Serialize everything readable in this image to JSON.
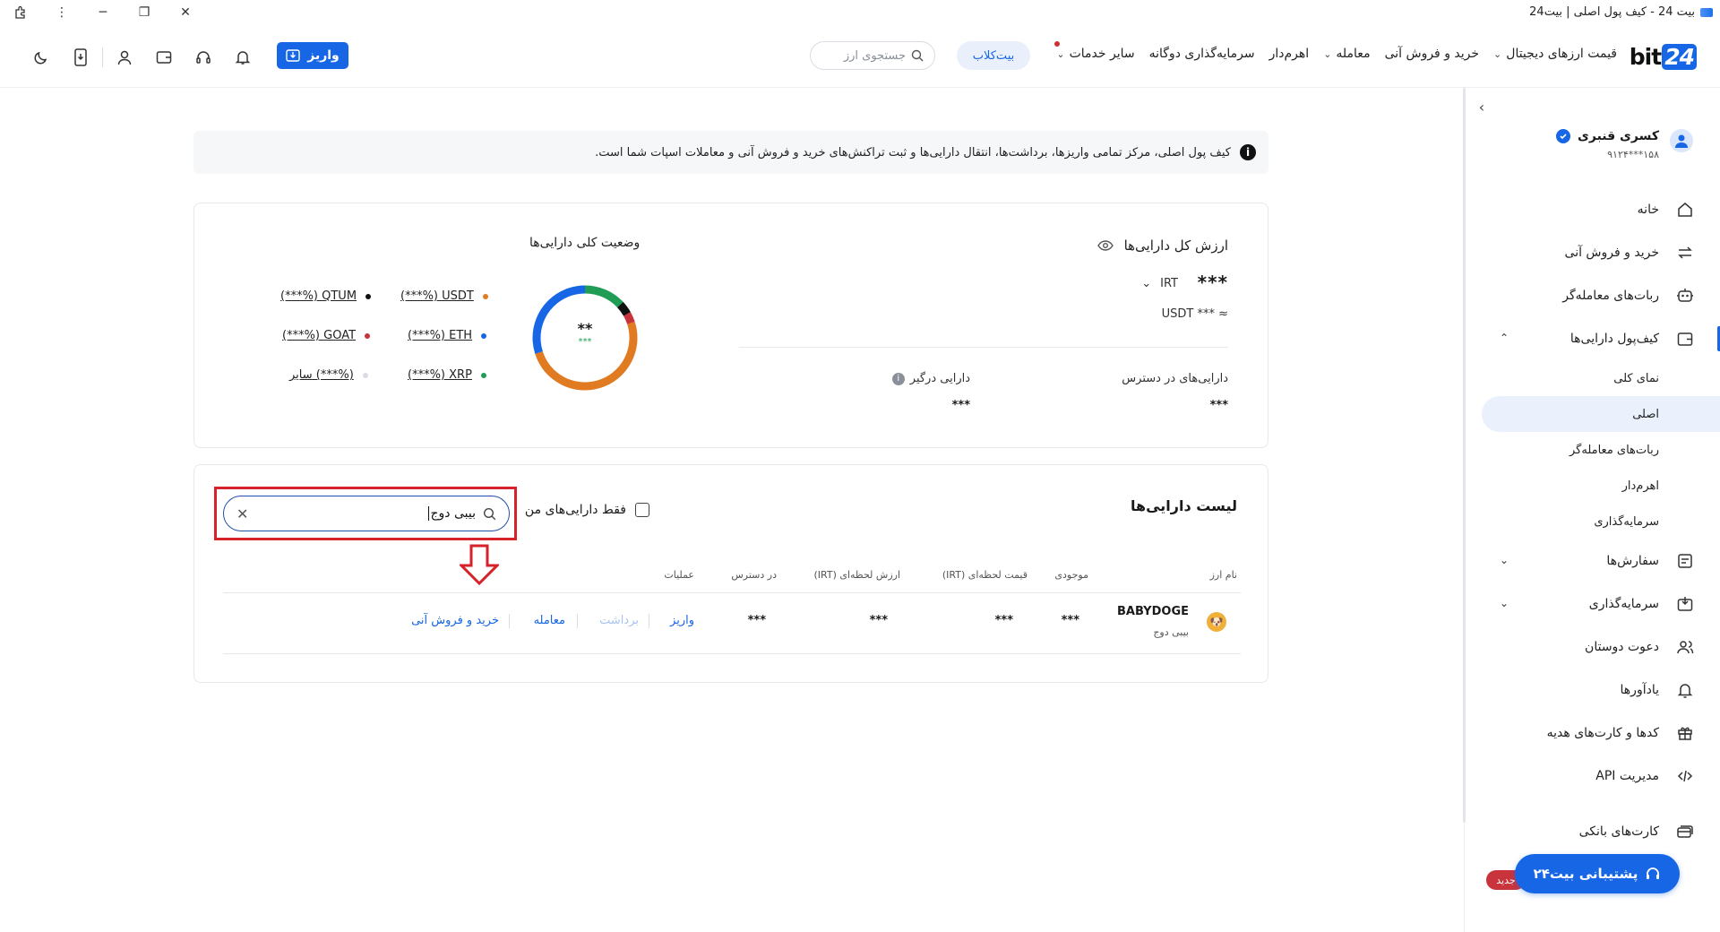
{
  "window": {
    "title": "بیت 24 - کیف پول اصلی | بیت24"
  },
  "nav": {
    "logo_text": "bit",
    "logo_num": "24",
    "links": [
      {
        "label": "قیمت ارزهای دیجیتال",
        "dropdown": true
      },
      {
        "label": "خرید و فروش آنی",
        "dropdown": false
      },
      {
        "label": "معامله",
        "dropdown": true
      },
      {
        "label": "اهرم‌دار",
        "dropdown": false
      },
      {
        "label": "سرمایه‌گذاری دوگانه",
        "dropdown": false
      },
      {
        "label": "سایر خدمات",
        "dropdown": true
      }
    ],
    "bitclub": "بیت‌کلاب",
    "search_placeholder": "جستجوی ارز",
    "deposit_label": "واریز"
  },
  "sidebar": {
    "user_name": "کسری قنبری",
    "user_phone": "۹۱۲۴***۱۵۸",
    "items": [
      {
        "label": "خانه",
        "icon": "home-icon"
      },
      {
        "label": "خرید و فروش آنی",
        "icon": "swap-icon"
      },
      {
        "label": "ربات‌های معامله‌گر",
        "icon": "robot-icon"
      },
      {
        "label": "کیف‌پول دارایی‌ها",
        "icon": "wallet-icon"
      }
    ],
    "wallet_subitems": [
      "نمای کلی",
      "اصلی",
      "ربات‌های معامله‌گر",
      "اهرم‌دار",
      "سرمایه‌گذاری"
    ],
    "items2": [
      {
        "label": "سفارش‌ها",
        "icon": "orders-icon"
      },
      {
        "label": "سرمایه‌گذاری",
        "icon": "invest-icon"
      },
      {
        "label": "دعوت دوستان",
        "icon": "users-icon"
      },
      {
        "label": "یادآورها",
        "icon": "bell-icon"
      },
      {
        "label": "کدها و کارت‌های هدیه",
        "icon": "gift-icon"
      },
      {
        "label": "مدیریت API",
        "icon": "code-icon"
      },
      {
        "label": "کارت‌های بانکی",
        "icon": "card-icon"
      }
    ],
    "support_label": "پشتیبانی بیت۲۴",
    "new_badge": "جدید"
  },
  "info": {
    "text": "کیف پول اصلی، مرکز تمامی واریزها، برداشت‌ها، انتقال دارایی‌ها و ثبت تراکنش‌های خرید و فروش آنی و معاملات اسپات شما است."
  },
  "total": {
    "title": "ارزش کل دارایی‌ها",
    "value": "***",
    "currency": "IRT",
    "usdt": "≈ *** USDT",
    "available_label": "دارایی‌های در دسترس",
    "available_value": "***",
    "locked_label": "دارایی درگیر",
    "locked_value": "***"
  },
  "status": {
    "title": "وضعیت کلی دارایی‌ها",
    "center_main": "**",
    "center_sub": "***",
    "legend": [
      {
        "label": "(***%) USDT",
        "color": "#e07b22"
      },
      {
        "label": "(***%) QTUM",
        "color": "#111111"
      },
      {
        "label": "(***%) ETH",
        "color": "#1766e6"
      },
      {
        "label": "(***%) GOAT",
        "color": "#c8333c"
      },
      {
        "label": "(***%) XRP",
        "color": "#1f9d55"
      },
      {
        "label": "سایر (***%)",
        "color": "#d9dde3"
      }
    ]
  },
  "assets": {
    "title": "لیست دارایی‌ها",
    "only_mine": "فقط دارایی‌های من",
    "search_value": "بیبی دوج",
    "headers": [
      "نام ارز",
      "موجودی",
      "قیمت لحظه‌ای (IRT)",
      "ارزش لحظه‌ای (IRT)",
      "در دسترس",
      "عملیات"
    ],
    "row": {
      "symbol": "BABYDOGE",
      "name": "بیبی دوج",
      "balance": "***",
      "price": "***",
      "value": "***",
      "available": "***",
      "actions": [
        "واریز",
        "برداشت",
        "معامله",
        "خرید و فروش آنی"
      ]
    }
  }
}
